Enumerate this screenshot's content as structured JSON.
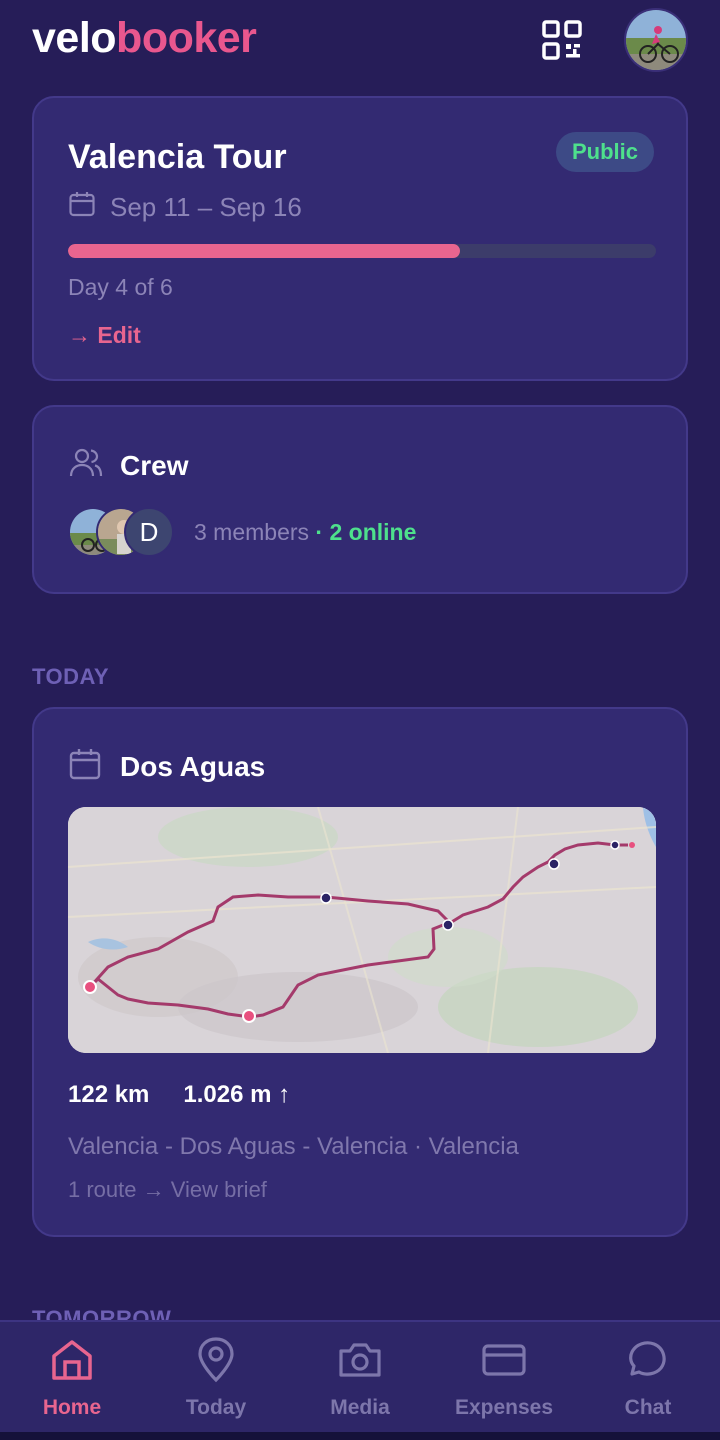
{
  "header": {
    "logo_part1": "velo",
    "logo_part2": "booker",
    "qr_icon": "qr-code-icon",
    "avatar": "profile-avatar"
  },
  "trip": {
    "title": "Valencia Tour",
    "visibility": "Public",
    "dates": "Sep 11 – Sep 16",
    "progress_fraction": 0.667,
    "day_text": "Day 4 of 6",
    "edit_label": "→ Edit"
  },
  "crew": {
    "title": "Crew",
    "member_initial": "D",
    "members_text": "3 members",
    "separator": " · ",
    "online_text": "2 online"
  },
  "sections": {
    "today": "TODAY",
    "tomorrow": "TOMORROW"
  },
  "today_card": {
    "title": "Dos Aguas",
    "distance": "122 km",
    "elevation": "1.026 m ↑",
    "route_name": "Valencia - Dos Aguas - Valencia · Valencia",
    "brief": "1 route → View brief"
  },
  "nav": {
    "items": [
      {
        "label": "Home",
        "icon": "home-icon",
        "active": true
      },
      {
        "label": "Today",
        "icon": "map-pin-icon",
        "active": false
      },
      {
        "label": "Media",
        "icon": "camera-icon",
        "active": false
      },
      {
        "label": "Expenses",
        "icon": "credit-card-icon",
        "active": false
      },
      {
        "label": "Chat",
        "icon": "chat-bubble-icon",
        "active": false
      }
    ]
  },
  "colors": {
    "background": "#261d58",
    "card": "#332a72",
    "accent": "#e8658f",
    "online": "#4ee08c"
  }
}
